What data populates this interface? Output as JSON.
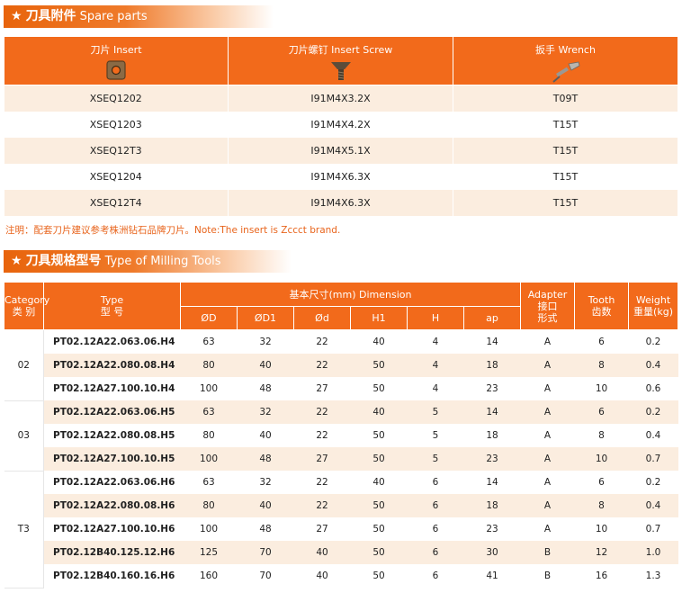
{
  "spare": {
    "title_cn": "刀具附件",
    "title_en": "Spare parts",
    "headers": [
      {
        "label": "刀片 Insert",
        "icon": "insert-icon"
      },
      {
        "label": "刀片螺钉 Insert Screw",
        "icon": "screw-icon"
      },
      {
        "label": "扳手 Wrench",
        "icon": "wrench-icon"
      }
    ],
    "rows": [
      [
        "XSEQ1202",
        "I91M4X3.2X",
        "T09T"
      ],
      [
        "XSEQ1203",
        "I91M4X4.2X",
        "T15T"
      ],
      [
        "XSEQ12T3",
        "I91M4X5.1X",
        "T15T"
      ],
      [
        "XSEQ1204",
        "I91M4X6.3X",
        "T15T"
      ],
      [
        "XSEQ12T4",
        "I91M4X6.3X",
        "T15T"
      ]
    ]
  },
  "note": "注明：配套刀片建议参考株洲钻石品牌刀片。Note:The insert is Zccct brand.",
  "milling": {
    "title_cn": "刀具规格型号",
    "title_en": "Type of Milling Tools",
    "headers": {
      "category": "Category\n类 别",
      "type": "Type\n型 号",
      "dimension": "基本尺寸(mm)  Dimension",
      "dims": [
        "ØD",
        "ØD1",
        "Ød",
        "H1",
        "H",
        "ap"
      ],
      "adapter": "Adapter\n接口\n形式",
      "tooth": "Tooth\n齿数",
      "weight": "Weight\n重量(kg)"
    },
    "groups": [
      {
        "category": "02",
        "rows": [
          [
            "PT02.12A22.063.06.H4",
            "63",
            "32",
            "22",
            "40",
            "4",
            "14",
            "A",
            "6",
            "0.2"
          ],
          [
            "PT02.12A22.080.08.H4",
            "80",
            "40",
            "22",
            "50",
            "4",
            "18",
            "A",
            "8",
            "0.4"
          ],
          [
            "PT02.12A27.100.10.H4",
            "100",
            "48",
            "27",
            "50",
            "4",
            "23",
            "A",
            "10",
            "0.6"
          ]
        ]
      },
      {
        "category": "03",
        "rows": [
          [
            "PT02.12A22.063.06.H5",
            "63",
            "32",
            "22",
            "40",
            "5",
            "14",
            "A",
            "6",
            "0.2"
          ],
          [
            "PT02.12A22.080.08.H5",
            "80",
            "40",
            "22",
            "50",
            "5",
            "18",
            "A",
            "8",
            "0.4"
          ],
          [
            "PT02.12A27.100.10.H5",
            "100",
            "48",
            "27",
            "50",
            "5",
            "23",
            "A",
            "10",
            "0.7"
          ]
        ]
      },
      {
        "category": "T3",
        "rows": [
          [
            "PT02.12A22.063.06.H6",
            "63",
            "32",
            "22",
            "40",
            "6",
            "14",
            "A",
            "6",
            "0.2"
          ],
          [
            "PT02.12A22.080.08.H6",
            "80",
            "40",
            "22",
            "50",
            "6",
            "18",
            "A",
            "8",
            "0.4"
          ],
          [
            "PT02.12A27.100.10.H6",
            "100",
            "48",
            "27",
            "50",
            "6",
            "23",
            "A",
            "10",
            "0.7"
          ],
          [
            "PT02.12B40.125.12.H6",
            "125",
            "70",
            "40",
            "50",
            "6",
            "30",
            "B",
            "12",
            "1.0"
          ],
          [
            "PT02.12B40.160.16.H6",
            "160",
            "70",
            "40",
            "50",
            "6",
            "41",
            "B",
            "16",
            "1.3"
          ]
        ]
      }
    ]
  }
}
